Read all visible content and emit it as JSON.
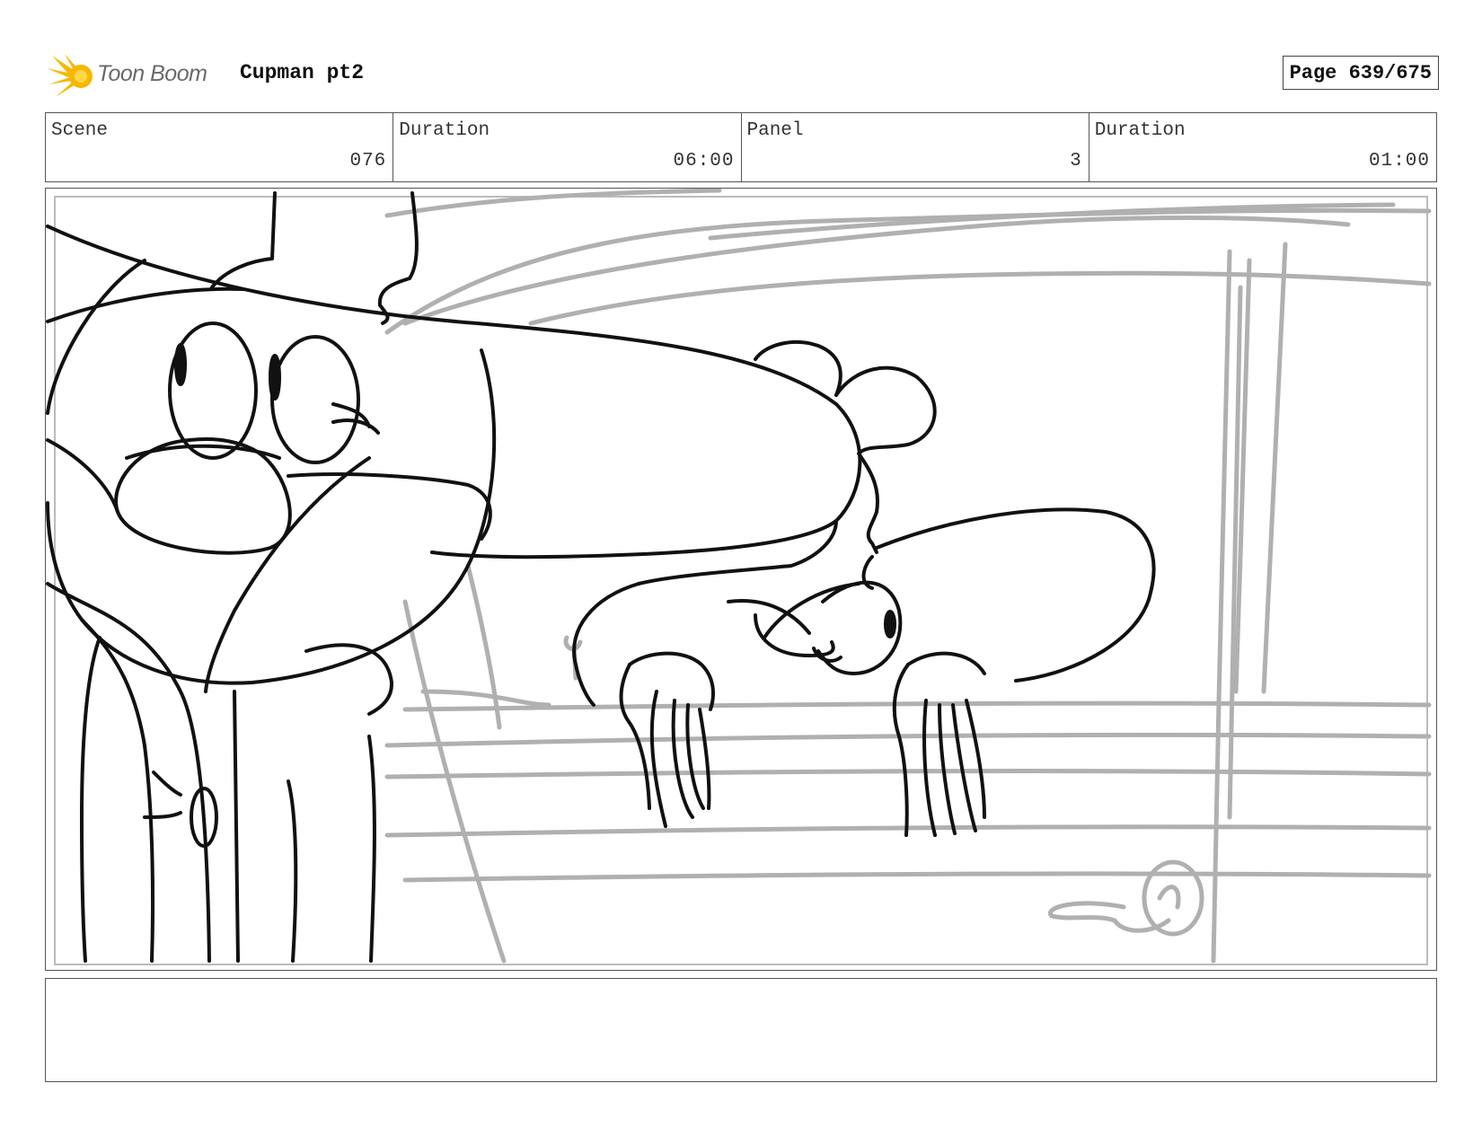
{
  "header": {
    "logo_text": "Toon Boom",
    "project_title": "Cupman pt2",
    "page_label": "Page 639/675"
  },
  "info": {
    "scene_label": "Scene",
    "scene_value": "076",
    "scene_duration_label": "Duration",
    "scene_duration_value": "06:00",
    "panel_label": "Panel",
    "panel_value": "3",
    "panel_duration_label": "Duration",
    "panel_duration_value": "01:00"
  },
  "colors": {
    "logo_accent": "#f5b800",
    "ink": "#111111",
    "rough_pencil": "#b0b0b0"
  },
  "notes": {
    "text": ""
  }
}
